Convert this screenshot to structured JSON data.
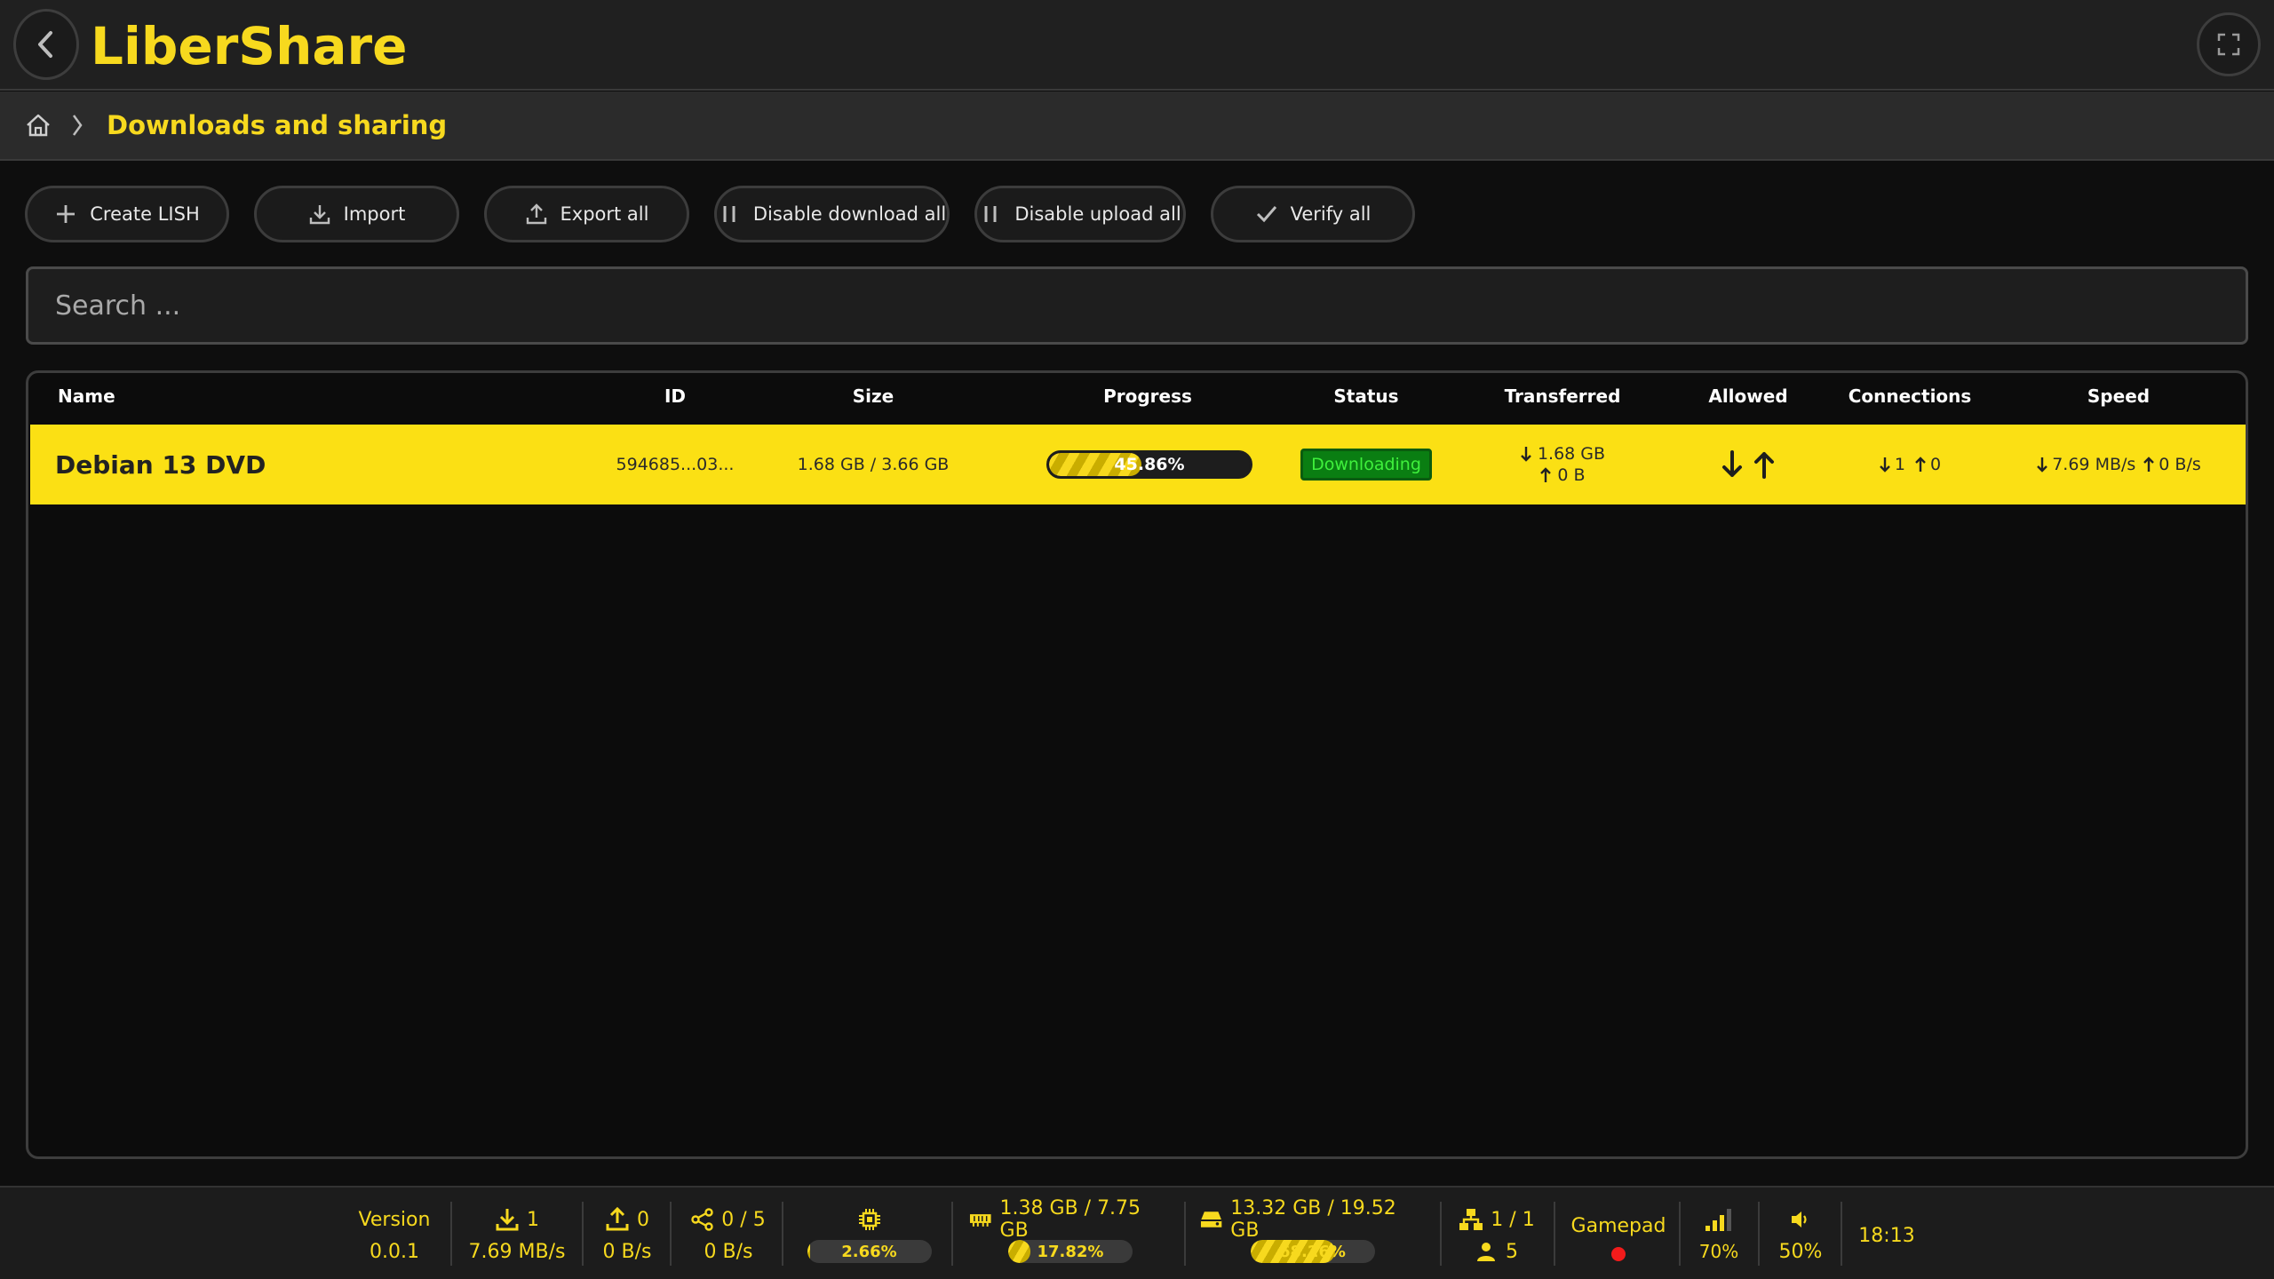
{
  "app": {
    "title": "LiberShare",
    "accent_color": "#f7d91e"
  },
  "breadcrumb": {
    "home_icon": "home-icon",
    "current": "Downloads and sharing"
  },
  "toolbar": {
    "buttons": [
      {
        "label": "Create LISH",
        "icon": "plus-icon"
      },
      {
        "label": "Import",
        "icon": "import-icon"
      },
      {
        "label": "Export all",
        "icon": "export-icon"
      },
      {
        "label": "Disable download all",
        "icon": "pause-icon"
      },
      {
        "label": "Disable upload all",
        "icon": "pause-icon"
      },
      {
        "label": "Verify all",
        "icon": "check-icon"
      }
    ]
  },
  "search": {
    "placeholder": "Search ..."
  },
  "table": {
    "columns": [
      "Name",
      "ID",
      "Size",
      "Progress",
      "Status",
      "Transferred",
      "Allowed",
      "Connections",
      "Speed"
    ],
    "rows": [
      {
        "name": "Debian 13 DVD",
        "id": "594685...03...",
        "size": "1.68 GB / 3.66 GB",
        "progress_text": "45.86%",
        "progress_value": 0.4586,
        "status": "Downloading",
        "transferred_down": "1.68 GB",
        "transferred_up": "0 B",
        "connections_down": "1",
        "connections_up": "0",
        "speed_down": "7.69 MB/s",
        "speed_up": "0 B/s"
      }
    ]
  },
  "statusbar": {
    "version_label": "Version",
    "version": "0.0.1",
    "downloads_count": "1",
    "download_speed": "7.69 MB/s",
    "uploads_count": "0",
    "upload_speed": "0 B/s",
    "shares": "0 / 5",
    "share_speed": "0 B/s",
    "cpu_text": "2.66%",
    "cpu_value": 0.0266,
    "ram": "1.38 GB / 7.75 GB",
    "ram_text": "17.82%",
    "ram_value": 0.1782,
    "disk": "13.32 GB / 19.52 GB",
    "disk_text": "68.26%",
    "disk_value": 0.6826,
    "network": "1 / 1",
    "peers": "5",
    "gamepad_label": "Gamepad",
    "signal": "70%",
    "volume": "50%",
    "clock": "18:13"
  }
}
